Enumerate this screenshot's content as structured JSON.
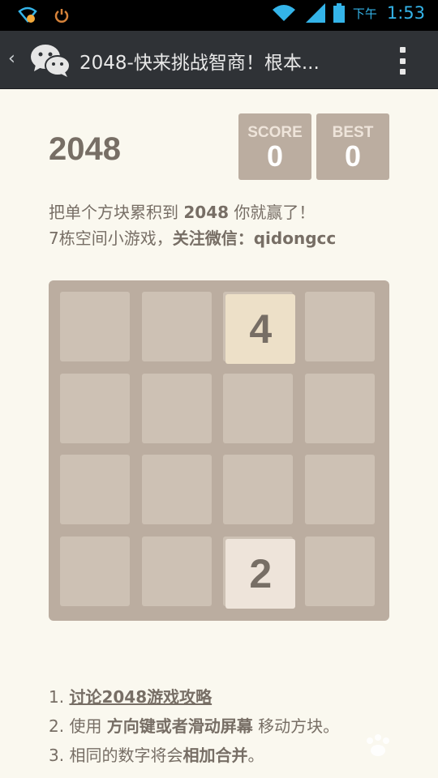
{
  "status_bar": {
    "ampm": "下午",
    "time": "1:53"
  },
  "app_bar": {
    "title": "2048-快来挑战智商！根本..."
  },
  "game": {
    "title": "2048",
    "score_label": "SCORE",
    "score_value": "0",
    "best_label": "BEST",
    "best_value": "0",
    "intro_line1_pre": "把单个方块累积到 ",
    "intro_line1_bold": "2048",
    "intro_line1_post": " 你就赢了！",
    "intro_line2_pre": "7栋空间小游戏，",
    "intro_line2_bold": "关注微信：qidongcc",
    "grid": [
      [
        0,
        0,
        4,
        0
      ],
      [
        0,
        0,
        0,
        0
      ],
      [
        0,
        0,
        0,
        0
      ],
      [
        0,
        0,
        2,
        0
      ]
    ],
    "tile_colors": {
      "2": "#eee4da",
      "4": "#ede0c8"
    }
  },
  "instructions": {
    "item1_num": "1. ",
    "item1_link": "讨论2048游戏攻略",
    "item2_pre": "2. 使用 ",
    "item2_bold": "方向键或者滑动屏幕",
    "item2_post": " 移动方块。",
    "item3_pre": "3. 相同的数字将会",
    "item3_bold": "相加合并",
    "item3_post": "。"
  }
}
